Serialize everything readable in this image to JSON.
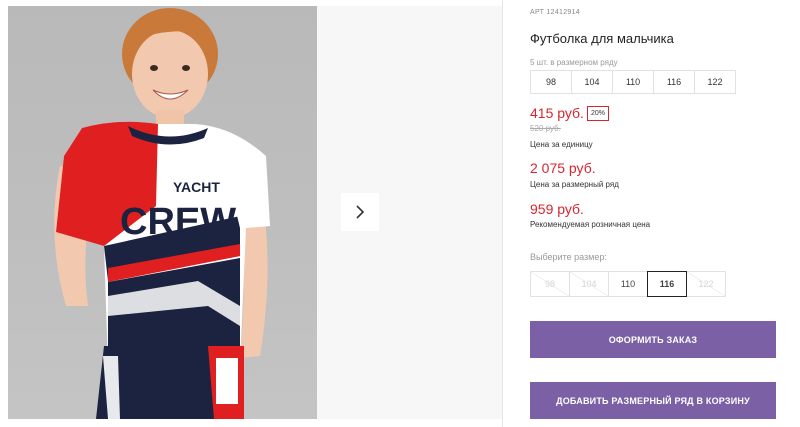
{
  "gallery": {
    "photo_print_text_1": "YACHT",
    "photo_print_text_2": "CREW",
    "next_icon": "chevron-right-icon"
  },
  "product": {
    "article_label": "АРТ",
    "article_number": "12412914",
    "title": "Футболка для мальчика",
    "size_row_label": "5 шт. в размерном ряду",
    "size_row": [
      "98",
      "104",
      "110",
      "116",
      "122"
    ]
  },
  "pricing": {
    "unit_price": "415 руб.",
    "discount": "20%",
    "old_price": "520 руб.",
    "unit_caption": "Цена за единицу",
    "row_price": "2 075 руб.",
    "row_caption": "Цена за размерный ряд",
    "retail_price": "959 руб.",
    "retail_caption": "Рекомендуемая розничная цена"
  },
  "size_picker": {
    "label": "Выберите размер:",
    "options": [
      {
        "label": "98",
        "available": false
      },
      {
        "label": "104",
        "available": false
      },
      {
        "label": "110",
        "available": true
      },
      {
        "label": "116",
        "available": true,
        "selected": true
      },
      {
        "label": "122",
        "available": false
      }
    ]
  },
  "actions": {
    "order_label": "ОФОРМИТЬ ЗАКАЗ",
    "add_row_label": "ДОБАВИТЬ РАЗМЕРНЫЙ РЯД В КОРЗИНУ"
  },
  "colors": {
    "accent_button": "#7b60a6",
    "price_red": "#d7262f"
  }
}
